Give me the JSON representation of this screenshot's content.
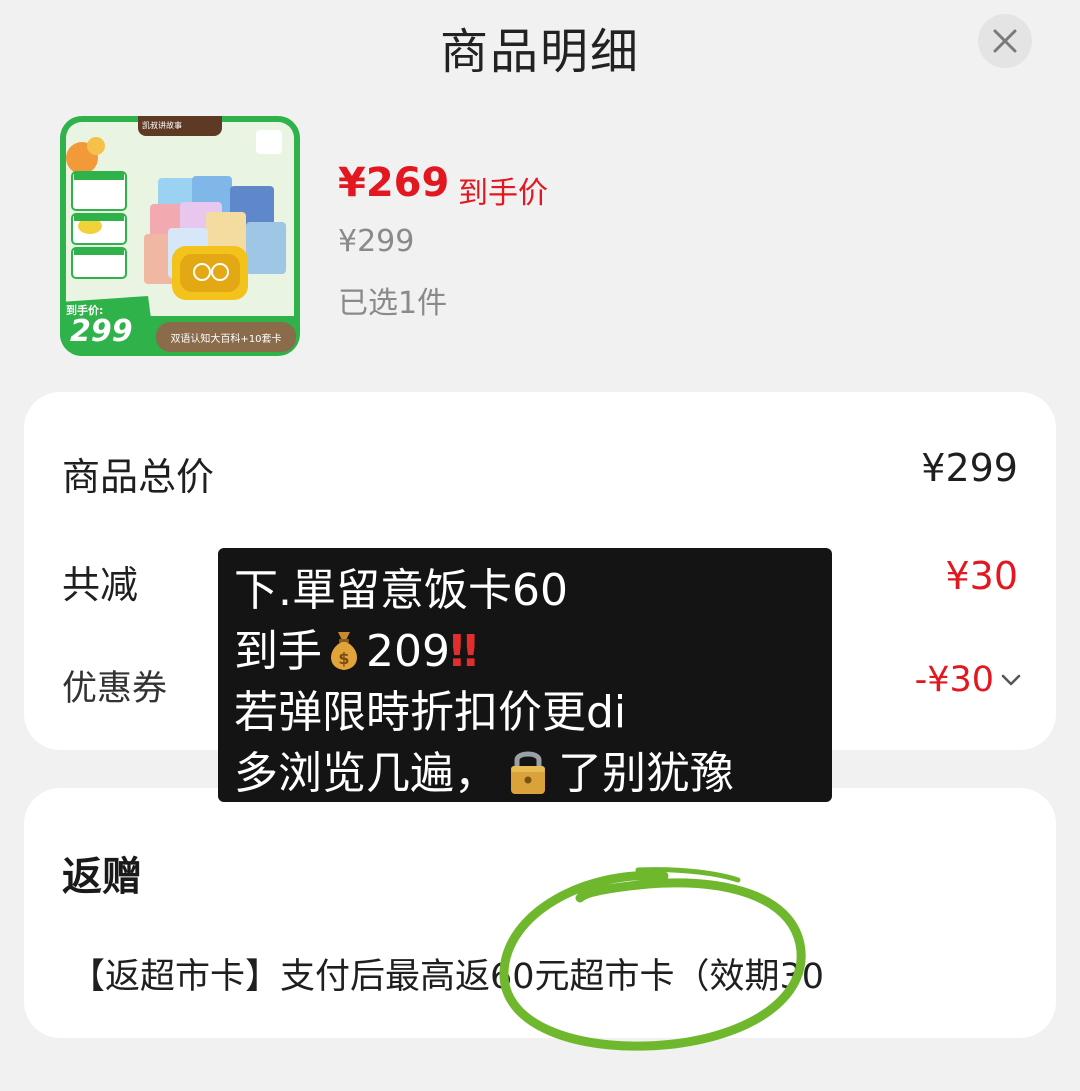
{
  "header": {
    "title": "商品明细",
    "close_icon": "close-icon"
  },
  "product": {
    "image": {
      "brand_text": "凯叔讲故事",
      "price_label": "到手价:",
      "price": "299",
      "banner": "双语认知大百科+10套卡"
    },
    "price_now": "¥269",
    "price_tag": "到手价",
    "price_original": "¥299",
    "selected_count": "已选1件"
  },
  "summary": {
    "total_label": "商品总价",
    "total_value": "¥299",
    "discount_label": "共减",
    "discount_value": "¥30",
    "coupon_label": "优惠券",
    "coupon_value": "-¥30"
  },
  "gift": {
    "title": "返赠",
    "text": "【返超市卡】支付后最高返60元超市卡（效期30"
  },
  "overlay": {
    "line1": "下.單留意饭卡60",
    "line2_a": "到手",
    "line2_b": "209",
    "line2_c": "‼",
    "line3": "若弹限時折扣价更di",
    "line4_a": "多浏览几遍，",
    "line4_b": "了别犹豫"
  },
  "colors": {
    "price_red": "#e3171f",
    "gray_text": "#8a8a8a",
    "doodle_green": "#6fb82e"
  }
}
